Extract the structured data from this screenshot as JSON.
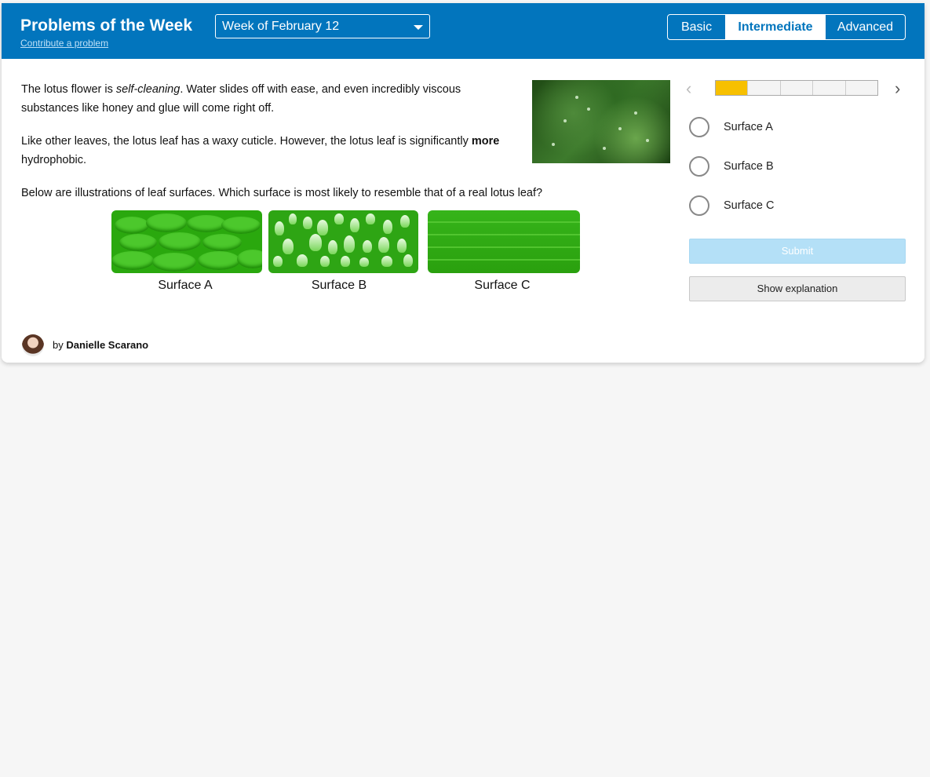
{
  "header": {
    "title": "Problems of the Week",
    "contribute_link": "Contribute a problem",
    "week_select": "Week of February 12",
    "levels": [
      "Basic",
      "Intermediate",
      "Advanced"
    ],
    "active_level": "Intermediate"
  },
  "problem": {
    "p1_pre": "The lotus flower is ",
    "p1_em": "self-cleaning",
    "p1_post": ". Water slides off with ease, and even incredibly viscous substances like honey and glue will come right off.",
    "p2_pre": "Like other leaves, the lotus leaf has a waxy cuticle. However, the lotus leaf is significantly ",
    "p2_strong": "more",
    "p2_post": " hydrophobic.",
    "p3": "Below are illustrations of leaf surfaces. Which surface is most likely to resemble that of a real lotus leaf?",
    "surface_labels": [
      "Surface A",
      "Surface B",
      "Surface C"
    ]
  },
  "progress": {
    "current": 1,
    "total": 5
  },
  "options": [
    "Surface A",
    "Surface B",
    "Surface C"
  ],
  "buttons": {
    "submit": "Submit",
    "explain": "Show explanation"
  },
  "author": {
    "prefix": "by ",
    "name": "Danielle Scarano"
  },
  "colors": {
    "header": "#0275bd",
    "progress_fill": "#f7c000",
    "submit_disabled": "#b4e0f7"
  }
}
